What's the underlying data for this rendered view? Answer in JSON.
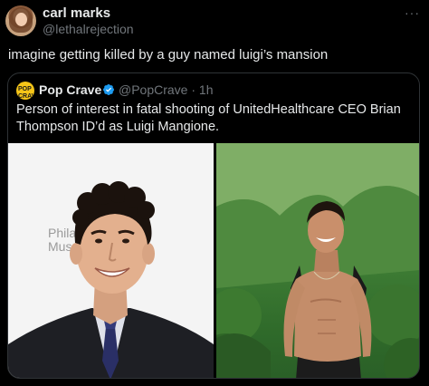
{
  "tweet": {
    "display_name": "carl marks",
    "handle": "@lethalrejection",
    "more_icon": "more-horizontal-icon",
    "text": "imagine getting killed by a guy named luigi’s mansion"
  },
  "quote": {
    "display_name": "Pop Crave",
    "avatar_text": "POP CRAVE",
    "verified_icon": "verified-badge-icon",
    "verified_color": "#1d9bf0",
    "handle_time": "@PopCrave · 1h",
    "text": "Person of interest in fatal shooting of UnitedHealthcare CEO Brian Thompson ID’d as Luigi Mangione.",
    "images": {
      "left_backdrop": "Philad Muse"
    }
  }
}
